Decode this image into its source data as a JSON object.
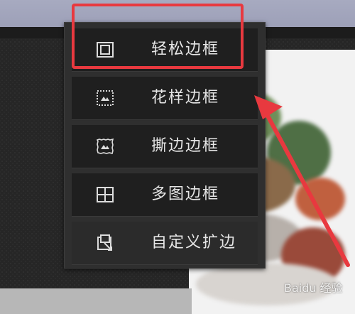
{
  "menu": {
    "items": [
      {
        "label": "轻松边框",
        "icon": "simple-border-icon"
      },
      {
        "label": "花样边框",
        "icon": "pattern-border-icon"
      },
      {
        "label": "撕边边框",
        "icon": "torn-border-icon"
      },
      {
        "label": "多图边框",
        "icon": "multi-image-border-icon"
      },
      {
        "label": "自定义扩边",
        "icon": "custom-extend-icon"
      }
    ]
  },
  "annotation": {
    "color": "#e8393f"
  },
  "watermark": {
    "text": "Baidu 经验"
  }
}
